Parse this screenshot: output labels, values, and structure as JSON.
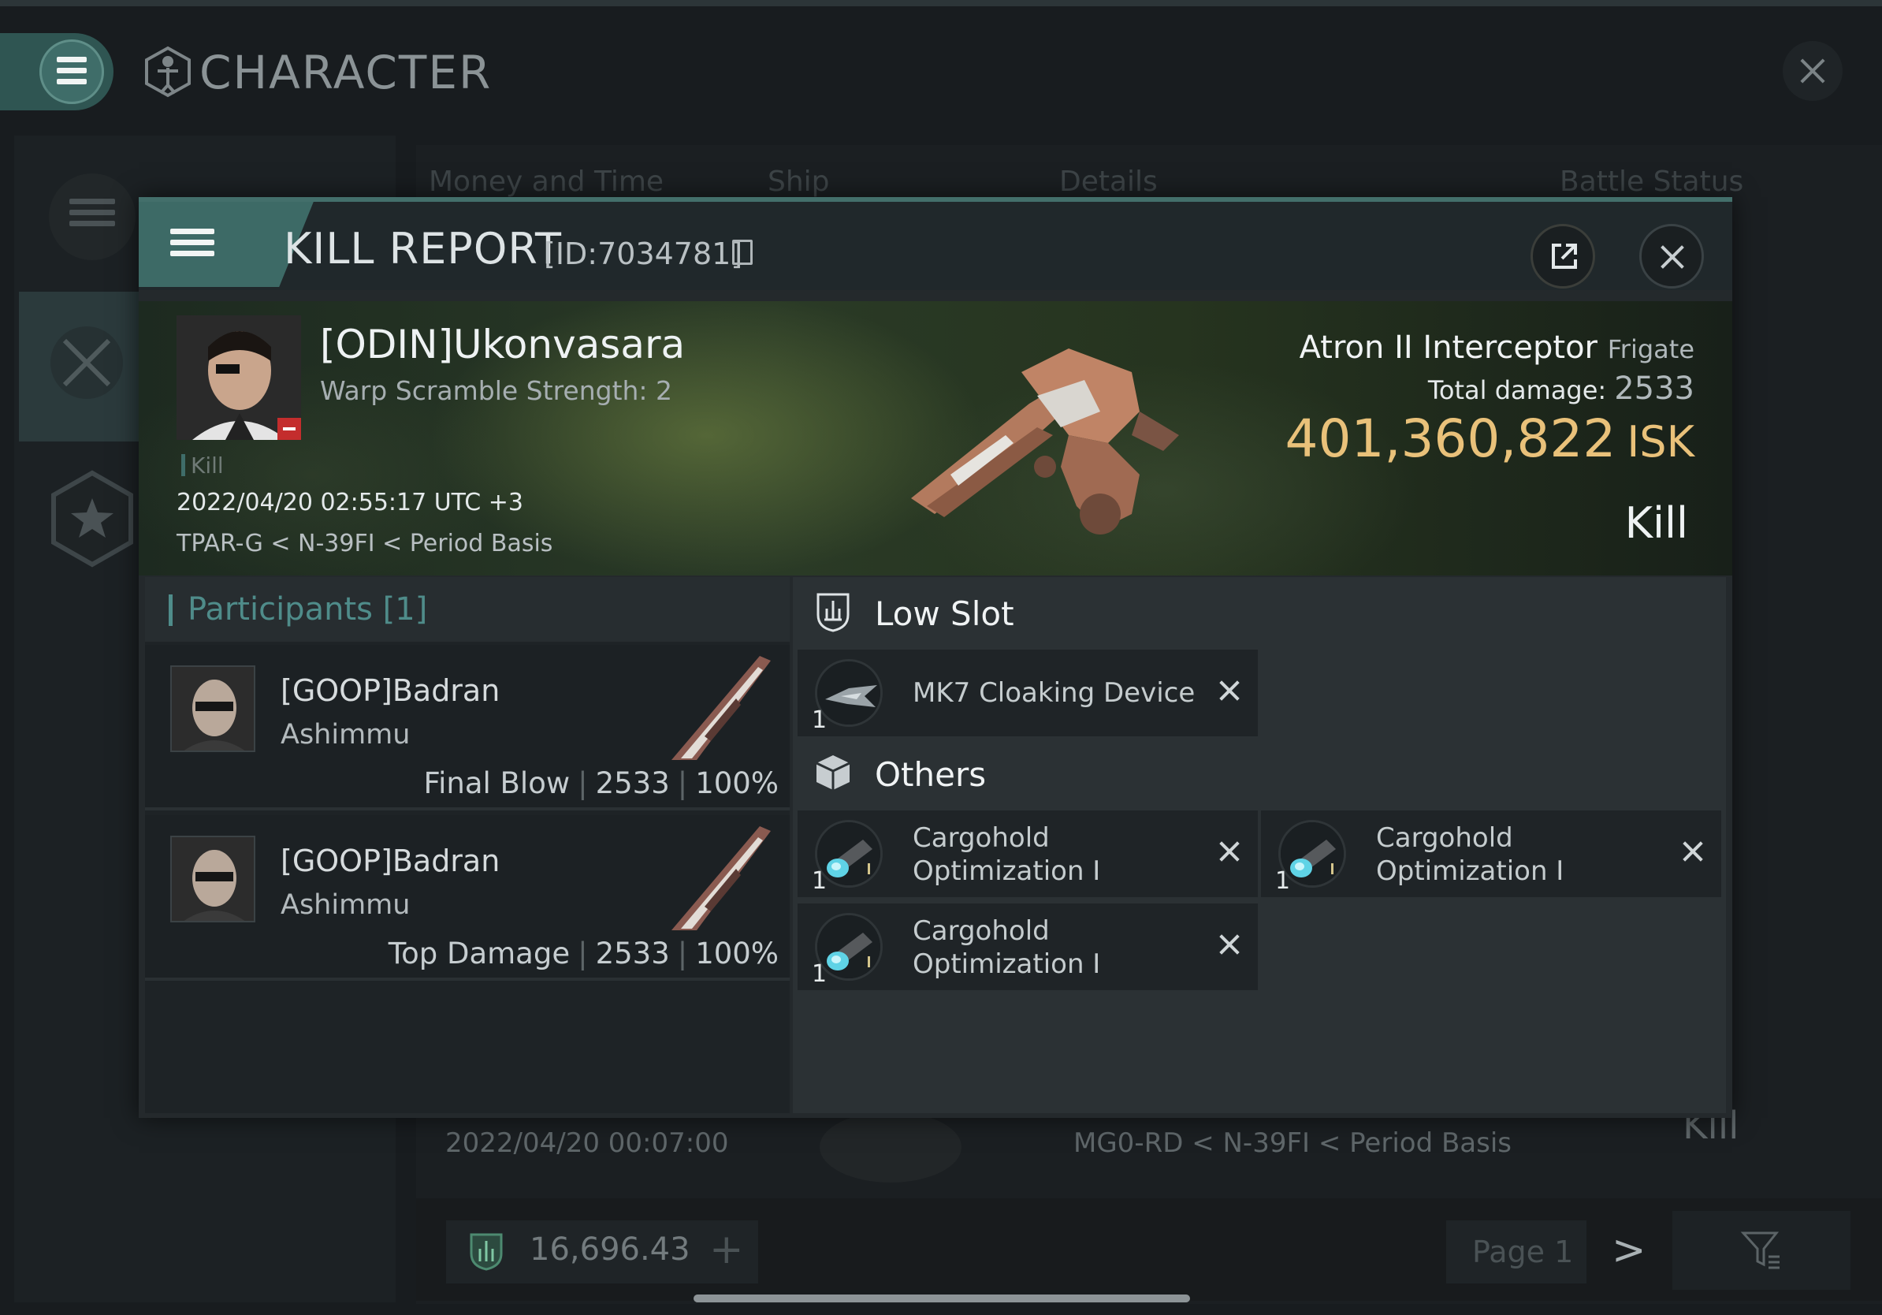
{
  "app": {
    "title": "CHARACTER",
    "tabs": [
      "Money and Time",
      "Ship",
      "Details",
      "Battle Status"
    ],
    "list_row": {
      "date": "2022/04/20  00:07:00",
      "location": "MG0-RD < N-39FI < Period Basis",
      "result": "Kill"
    },
    "wallet_value": "16,696.43",
    "wallet_add": "+",
    "page_label": "Page 1",
    "page_next": ">"
  },
  "kill_report": {
    "title": "KILL REPORT",
    "id_label": "[ID:7034781]",
    "victim": {
      "name": "[ODIN]Ukonvasara",
      "warp_scramble": "Warp Scramble Strength: 2",
      "kill_tag": "Kill",
      "datetime": "2022/04/20 02:55:17 UTC +3",
      "location": "TPAR-G < N-39FI < Period Basis"
    },
    "ship": {
      "name": "Atron II Interceptor",
      "class": "Frigate",
      "total_damage_label": "Total damage:",
      "total_damage": "2533",
      "isk_value": "401,360,822",
      "isk_unit": "ISK",
      "result": "Kill"
    },
    "participants": {
      "title": "Participants [1]",
      "rows": [
        {
          "name": "[GOOP]Badran",
          "ship": "Ashimmu",
          "role": "Final Blow",
          "damage": "2533",
          "percent": "100%"
        },
        {
          "name": "[GOOP]Badran",
          "ship": "Ashimmu",
          "role": "Top Damage",
          "damage": "2533",
          "percent": "100%"
        }
      ],
      "separator": "|"
    },
    "slots": {
      "low_slot_title": "Low Slot",
      "low_slot_items": [
        {
          "name": "MK7 Cloaking Device",
          "qty": "1"
        }
      ],
      "others_title": "Others",
      "others_items": [
        {
          "name_line1": "Cargohold",
          "name_line2": "Optimization I",
          "qty": "1"
        },
        {
          "name_line1": "Cargohold",
          "name_line2": "Optimization I",
          "qty": "1"
        },
        {
          "name_line1": "Cargohold",
          "name_line2": "Optimization I",
          "qty": "1"
        }
      ]
    }
  },
  "colors": {
    "accent_teal": "#3d6a66",
    "isk_gold": "#e9c17a",
    "participants_teal": "#4f8c8a",
    "minus_red": "#c42d2d"
  }
}
